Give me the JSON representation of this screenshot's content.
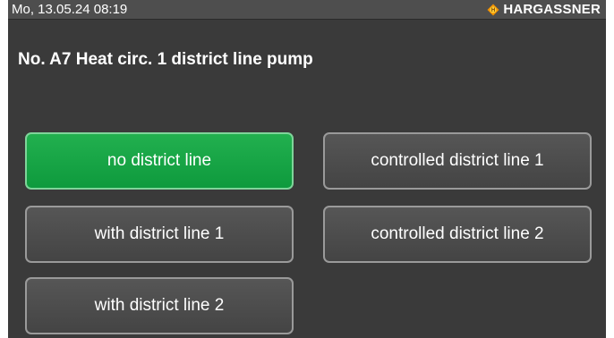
{
  "status_bar": {
    "datetime": "Mo, 13.05.24 08:19",
    "brand": "HARGASSNER"
  },
  "page": {
    "title": "No. A7 Heat circ. 1 district line pump"
  },
  "options": [
    {
      "label": "no district line",
      "selected": true
    },
    {
      "label": "controlled district line 1",
      "selected": false
    },
    {
      "label": "with district line 1",
      "selected": false
    },
    {
      "label": "controlled district line 2",
      "selected": false
    },
    {
      "label": "with district line 2",
      "selected": false
    }
  ],
  "colors": {
    "screen_background": "#3a3a3a",
    "status_bar": "#4e4e4e",
    "selected_option": "#19a748",
    "button": "#4c4c4c",
    "logo_orange": "#f39200"
  },
  "icons": {
    "brand_logo": "hargassner-logo-icon"
  }
}
